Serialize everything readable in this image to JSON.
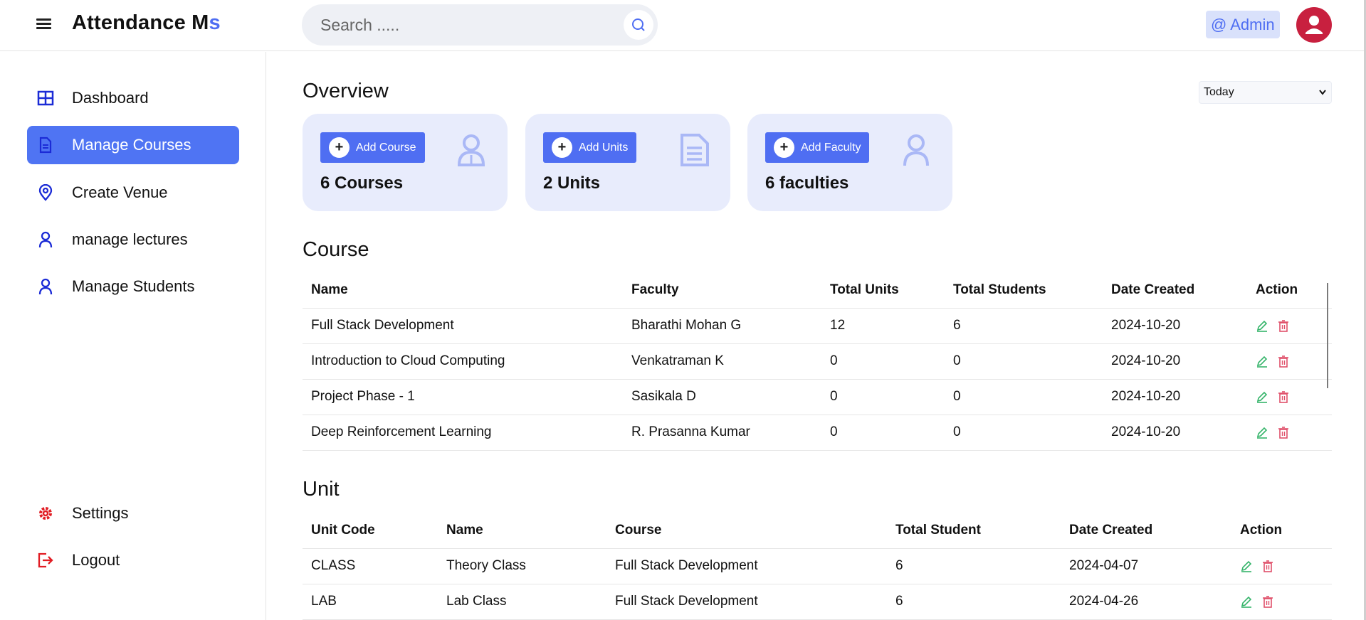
{
  "app": {
    "brand_main": "Attendance M",
    "brand_accent": "s"
  },
  "search": {
    "placeholder": "Search ....."
  },
  "user": {
    "label": "@ Admin"
  },
  "sidebar": {
    "items": [
      {
        "label": "Dashboard",
        "icon": "grid-icon"
      },
      {
        "label": "Manage Courses",
        "icon": "document-icon",
        "active": true
      },
      {
        "label": "Create Venue",
        "icon": "location-pin-icon"
      },
      {
        "label": "manage lectures",
        "icon": "user-icon"
      },
      {
        "label": "Manage Students",
        "icon": "user-icon"
      }
    ],
    "bottom": [
      {
        "label": "Settings",
        "icon": "gear-icon"
      },
      {
        "label": "Logout",
        "icon": "logout-icon"
      }
    ]
  },
  "overview": {
    "title": "Overview",
    "period": "Today",
    "cards": [
      {
        "button": "Add Course",
        "count": "6 Courses",
        "icon": "teacher-icon"
      },
      {
        "button": "Add Units",
        "count": "2 Units",
        "icon": "file-icon"
      },
      {
        "button": "Add Faculty",
        "count": "6 faculties",
        "icon": "user-outline-icon"
      }
    ]
  },
  "course": {
    "title": "Course",
    "headers": [
      "Name",
      "Faculty",
      "Total Units",
      "Total Students",
      "Date Created",
      "Action"
    ],
    "rows": [
      [
        "Full Stack Development",
        "Bharathi Mohan G",
        "12",
        "6",
        "2024-10-20"
      ],
      [
        "Introduction to Cloud Computing",
        "Venkatraman K",
        "0",
        "0",
        "2024-10-20"
      ],
      [
        "Project Phase - 1",
        "Sasikala D",
        "0",
        "0",
        "2024-10-20"
      ],
      [
        "Deep Reinforcement Learning",
        "R. Prasanna Kumar",
        "0",
        "0",
        "2024-10-20"
      ]
    ]
  },
  "unit": {
    "title": "Unit",
    "headers": [
      "Unit Code",
      "Name",
      "Course",
      "Total Student",
      "Date Created",
      "Action"
    ],
    "rows": [
      [
        "CLASS",
        "Theory Class",
        "Full Stack Development",
        "6",
        "2024-04-07"
      ],
      [
        "LAB",
        "Lab Class",
        "Full Stack Development",
        "6",
        "2024-04-26"
      ]
    ]
  },
  "colors": {
    "accent": "#4f6ef2",
    "card_bg": "#e8ecfc",
    "avatar": "#c8203f",
    "edit": "#35b46a",
    "delete": "#e0506a",
    "nav_icon": "#1b2bd6",
    "danger_icon": "#e11d24"
  }
}
